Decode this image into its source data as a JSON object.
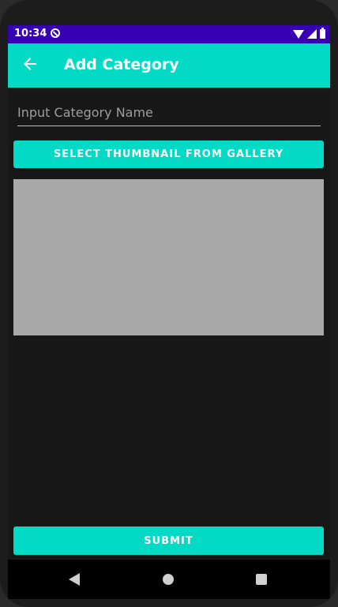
{
  "status_bar": {
    "time": "10:34",
    "app_icon": "sync-disabled-icon",
    "right_icons": [
      "wifi-icon",
      "signal-icon",
      "battery-icon"
    ]
  },
  "app_bar": {
    "title": "Add Category",
    "back_icon": "arrow-back-icon",
    "color": "#03dac5"
  },
  "form": {
    "category_name": {
      "value": "",
      "placeholder": "Input Category Name"
    },
    "select_thumbnail_label": "SELECT THUMBNAIL FROM GALLERY",
    "thumbnail_color": "#a9a9a9",
    "submit_label": "SUBMIT"
  },
  "nav_bar": {
    "icons": [
      "nav-back-icon",
      "nav-home-icon",
      "nav-recents-icon"
    ]
  },
  "colors": {
    "status_bar": "#3700b3",
    "accent": "#03dac5",
    "background": "#181818"
  }
}
